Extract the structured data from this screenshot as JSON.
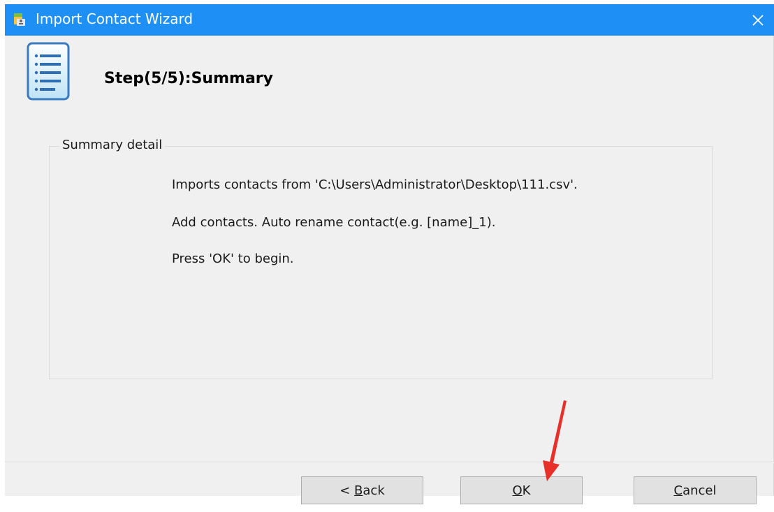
{
  "window": {
    "title": "Import Contact Wizard",
    "title_bar_color": "#1e90f5",
    "close_glyph": "✕"
  },
  "header": {
    "step_title": "Step(5/5):Summary",
    "icon": "document-list-icon"
  },
  "summary": {
    "group_label": "Summary detail",
    "lines": [
      "Imports contacts from 'C:\\Users\\Administrator\\Desktop\\111.csv'.",
      "Add contacts. Auto rename contact(e.g. [name]_1).",
      "Press 'OK' to begin."
    ]
  },
  "buttons": {
    "back": {
      "prefix": "< ",
      "mnemonic": "B",
      "rest": "ack"
    },
    "ok": {
      "prefix": "",
      "mnemonic": "O",
      "rest": "K"
    },
    "cancel": {
      "prefix": "",
      "mnemonic": "C",
      "rest": "ancel"
    }
  },
  "annotation": {
    "arrow_color": "#e8302a"
  }
}
